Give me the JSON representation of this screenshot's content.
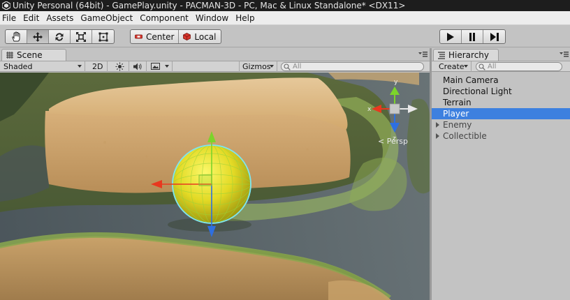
{
  "window": {
    "title": "Unity Personal (64bit) - GamePlay.unity - PACMAN-3D - PC, Mac & Linux Standalone* <DX11>"
  },
  "menu": {
    "items": [
      "File",
      "Edit",
      "Assets",
      "GameObject",
      "Component",
      "Window",
      "Help"
    ]
  },
  "toolbar": {
    "transform_tools": [
      "hand-tool",
      "move-tool",
      "rotate-tool",
      "scale-tool",
      "rect-tool"
    ],
    "active_tool": "move-tool",
    "pivot_mode": "Center",
    "pivot_rotation": "Local",
    "playback": [
      "play",
      "pause",
      "step"
    ]
  },
  "scene": {
    "tab_label": "Scene",
    "shading_mode": "Shaded",
    "mode_2d": "2D",
    "gizmos_label": "Gizmos",
    "search_placeholder": "All",
    "persp_label": "Persp",
    "axis_labels": {
      "y": "y",
      "x": "x",
      "z": "z"
    }
  },
  "hierarchy": {
    "tab_label": "Hierarchy",
    "create_label": "Create",
    "search_placeholder": "All",
    "items": [
      {
        "label": "Main Camera",
        "selected": false,
        "foldout": false
      },
      {
        "label": "Directional Light",
        "selected": false,
        "foldout": false
      },
      {
        "label": "Terrain",
        "selected": false,
        "foldout": false
      },
      {
        "label": "Player",
        "selected": true,
        "foldout": false
      },
      {
        "label": "Enemy",
        "selected": false,
        "foldout": true
      },
      {
        "label": "Collectible",
        "selected": false,
        "foldout": true
      }
    ]
  },
  "colors": {
    "selection": "#3d80df",
    "axis_x": "#e8381f",
    "axis_y": "#7cd42a",
    "axis_z": "#2e6fe0",
    "player_sphere": "#e6e21f"
  }
}
